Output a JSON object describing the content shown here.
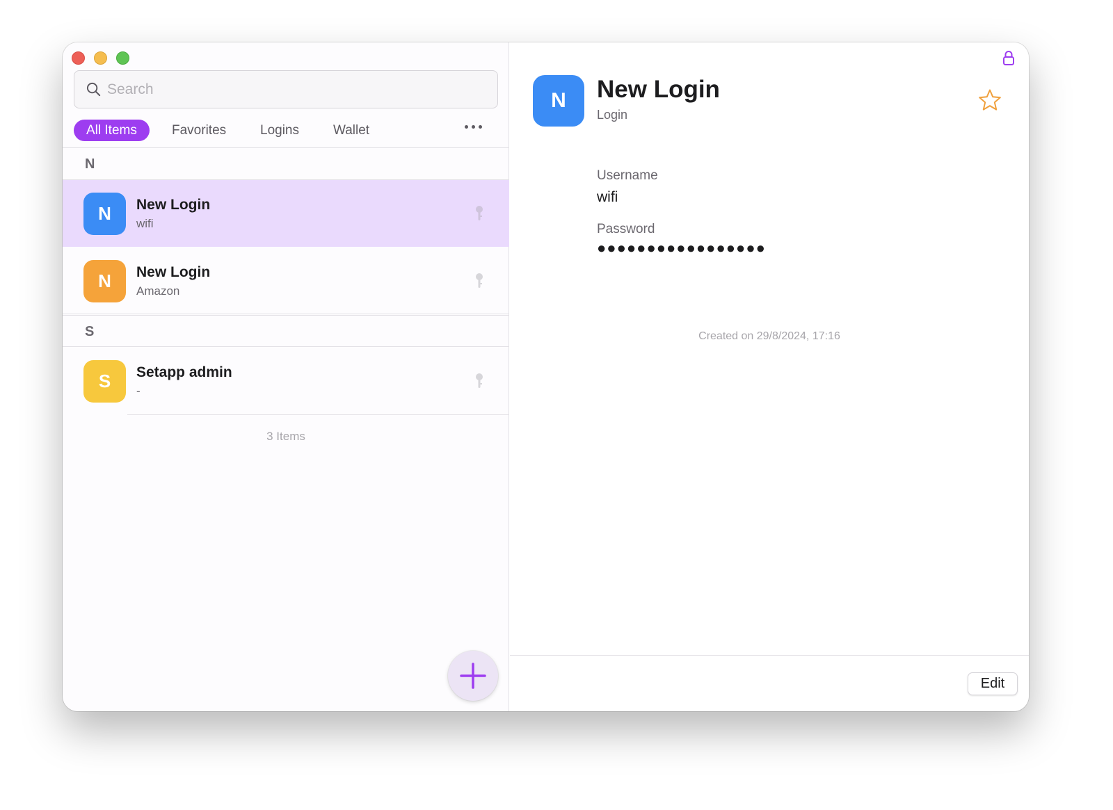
{
  "search": {
    "placeholder": "Search",
    "value": ""
  },
  "filters": [
    {
      "label": "All Items",
      "active": true
    },
    {
      "label": "Favorites",
      "active": false
    },
    {
      "label": "Logins",
      "active": false
    },
    {
      "label": "Wallet",
      "active": false
    }
  ],
  "sections": [
    {
      "letter": "N",
      "items": [
        {
          "initial": "N",
          "title": "New Login",
          "subtitle": "wifi",
          "color": "#3b8cf5",
          "selected": true,
          "icon": "key-icon"
        },
        {
          "initial": "N",
          "title": "New Login",
          "subtitle": "Amazon",
          "color": "#f5a33a",
          "selected": false,
          "icon": "key-icon"
        }
      ]
    },
    {
      "letter": "S",
      "items": [
        {
          "initial": "S",
          "title": "Setapp admin",
          "subtitle": "-",
          "color": "#f7c83d",
          "selected": false,
          "icon": "key-icon"
        }
      ]
    }
  ],
  "item_count": "3 Items",
  "detail": {
    "initial": "N",
    "title": "New Login",
    "type": "Login",
    "username_label": "Username",
    "username": "wifi",
    "password_label": "Password",
    "password": "●●●●●●●●●●●●●●●●●",
    "created": "Created on 29/8/2024, 17:16",
    "edit_label": "Edit"
  },
  "colors": {
    "accent": "#9d3df0",
    "selected_row": "#eadafd",
    "favorite_star": "#f0a03c"
  }
}
